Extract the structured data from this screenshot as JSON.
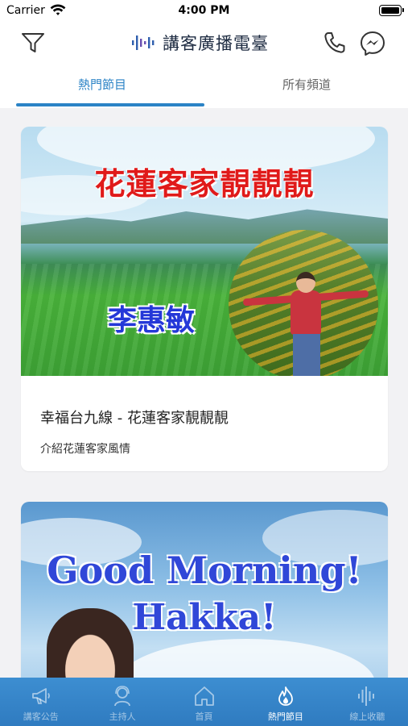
{
  "status_bar": {
    "carrier": "Carrier",
    "time": "4:00 PM"
  },
  "header": {
    "logo_text": "講客廣播電臺",
    "icons": [
      "filter-icon",
      "phone-icon",
      "messenger-icon"
    ]
  },
  "tabs": [
    {
      "label": "熱門節目",
      "active": true
    },
    {
      "label": "所有頻道",
      "active": false
    }
  ],
  "programs": [
    {
      "banner_title": "花蓮客家靚靚靚",
      "banner_host": "李惠敏",
      "title": "幸福台九線 - 花蓮客家靚靚靚",
      "description": "介紹花蓮客家風情"
    },
    {
      "banner_line1": "Good Morning!",
      "banner_line2": "Hakka!"
    }
  ],
  "bottom_nav": [
    {
      "label": "講客公告",
      "icon": "megaphone-icon",
      "active": false
    },
    {
      "label": "主持人",
      "icon": "host-icon",
      "active": false
    },
    {
      "label": "首頁",
      "icon": "home-icon",
      "active": false
    },
    {
      "label": "熱門節目",
      "icon": "flame-icon",
      "active": true
    },
    {
      "label": "線上收聽",
      "icon": "soundwave-icon",
      "active": false
    }
  ],
  "colors": {
    "accent": "#2b83c6",
    "tabbar": "#3587cb",
    "banner_title": "#e01a1a",
    "banner_host": "#2438d8"
  }
}
